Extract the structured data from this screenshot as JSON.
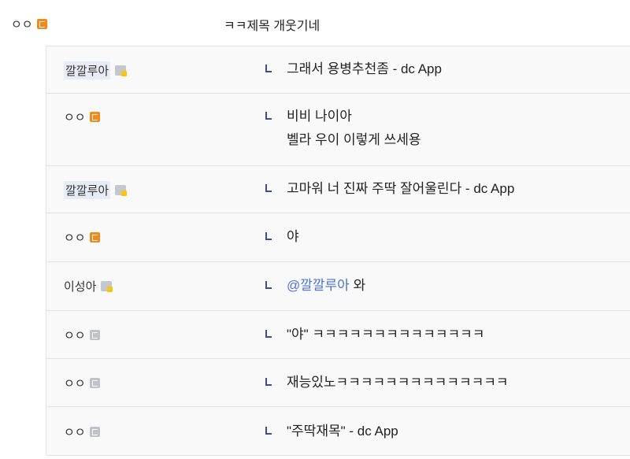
{
  "post": {
    "author": "ㅇㅇ",
    "author_icon": "fixed-nick-icon",
    "title": "ㅋㅋ제목 개웃기네"
  },
  "comments": [
    {
      "nick": "깔깔루아",
      "nick_icon": "half-fixed-nick-icon",
      "highlight": true,
      "lines": [
        "그래서 용병추천좀 - dc App"
      ]
    },
    {
      "nick": "ㅇㅇ",
      "nick_icon": "fixed-nick-icon",
      "highlight": false,
      "lines": [
        "비비 나이아",
        "벨라 우이 이렇게 쓰세용"
      ]
    },
    {
      "nick": "깔깔루아",
      "nick_icon": "half-fixed-nick-icon",
      "highlight": true,
      "lines": [
        "고마워 너 진짜 주딱 잘어울린다 - dc App"
      ]
    },
    {
      "nick": "ㅇㅇ",
      "nick_icon": "fixed-nick-icon",
      "highlight": false,
      "lines": [
        "야"
      ]
    },
    {
      "nick": "이성아",
      "nick_icon": "half-fixed-nick-icon",
      "highlight": false,
      "mention": "@깔깔루아",
      "lines": [
        "와"
      ]
    },
    {
      "nick": "ㅇㅇ",
      "nick_icon": "fixed-nick-light-icon",
      "highlight": false,
      "lines": [
        "\"야\" ㅋㅋㅋㅋㅋㅋㅋㅋㅋㅋㅋㅋㅋㅋ"
      ]
    },
    {
      "nick": "ㅇㅇ",
      "nick_icon": "fixed-nick-light-icon",
      "highlight": false,
      "lines": [
        "재능있노ㅋㅋㅋㅋㅋㅋㅋㅋㅋㅋㅋㅋㅋㅋ"
      ]
    },
    {
      "nick": "ㅇㅇ",
      "nick_icon": "fixed-nick-light-icon",
      "highlight": false,
      "lines": [
        "\"주딱재목\" - dc App"
      ]
    }
  ],
  "colors": {
    "reply_arrow": "#3b4b9e",
    "mention": "#4a73d9",
    "nick_highlight": "#e7ecf7",
    "fixed_icon": "#f08a1c"
  }
}
